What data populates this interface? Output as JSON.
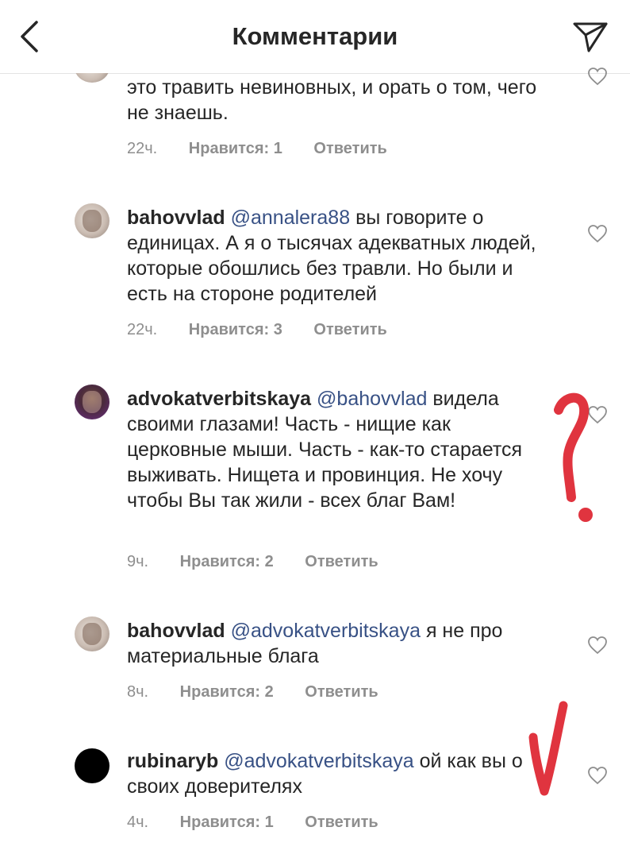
{
  "header": {
    "title": "Комментарии",
    "back_icon": "chevron-left-icon",
    "send_icon": "paper-plane-icon"
  },
  "comments": [
    {
      "username": "",
      "mention": "",
      "text": "это травить невиновных, и орать о том, чего не знаешь.",
      "time": "22ч.",
      "likes": "Нравится: 1",
      "reply": "Ответить"
    },
    {
      "username": "bahovvlad",
      "mention": "@annalera88",
      "text": "вы говорите о единицах.  А я о тысячах  адекватных людей,  которые обошлись без травли. Но были и есть на стороне родителей",
      "time": "22ч.",
      "likes": "Нравится: 3",
      "reply": "Ответить"
    },
    {
      "username": "advokatverbitskaya",
      "mention": "@bahovvlad",
      "text": "видела своими глазами! Часть - нищие как церковные мыши. Часть - как-то старается выживать. Нищета и провинция. Не хочу чтобы Вы так жили - всех благ Вам!",
      "time": "9ч.",
      "likes": "Нравится: 2",
      "reply": "Ответить"
    },
    {
      "username": "bahovvlad",
      "mention": "@advokatverbitskaya",
      "text": "я не про материальные блага",
      "time": "8ч.",
      "likes": "Нравится: 2",
      "reply": "Ответить"
    },
    {
      "username": "rubinaryb",
      "mention": "@advokatverbitskaya",
      "text": "ой как вы о своих доверителях",
      "time": "4ч.",
      "likes": "Нравится: 1",
      "reply": "Ответить"
    }
  ],
  "annotations": {
    "question_mark_color": "#e0343f",
    "check_mark_color": "#e0343f"
  },
  "colors": {
    "mention": "#385185",
    "meta": "#8e8e8e",
    "text": "#262626"
  }
}
